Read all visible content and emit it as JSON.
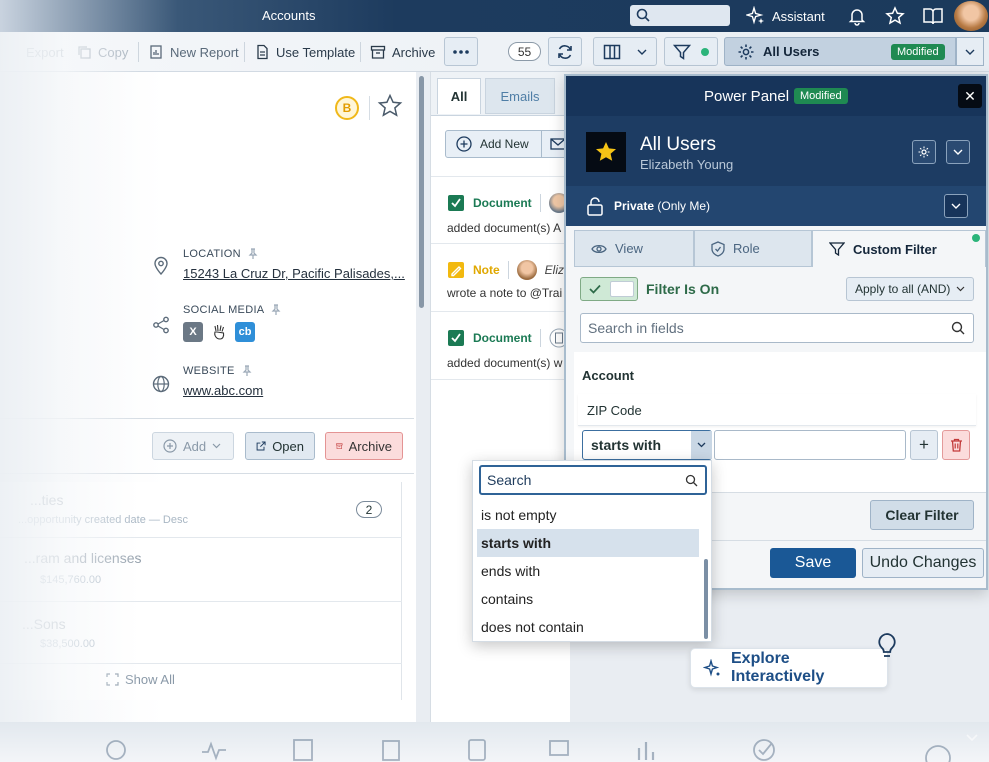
{
  "titlebar": {
    "title": "Accounts",
    "assistant_label": "Assistant"
  },
  "toolbar": {
    "export_label": "Export",
    "copy_label": "Copy",
    "new_report_label": "New Report",
    "use_template_label": "Use Template",
    "archive_label": "Archive",
    "count": "55",
    "view_name": "All Users",
    "view_status": "Modified"
  },
  "record": {
    "location_label": "LOCATION",
    "location_value": "15243 La Cruz Dr, Pacific Palisades,...",
    "social_label": "SOCIAL MEDIA",
    "website_label": "WEBSITE",
    "website_value": "www.abc.com",
    "coin_letter": "B",
    "actions": {
      "add": "Add",
      "open": "Open",
      "archive": "Archive"
    }
  },
  "related": {
    "section_title": "...ties",
    "section_sub": "...opportunity created date — Desc",
    "count": "2",
    "items": [
      {
        "name": "...ram and licenses",
        "value": "$145,760.00"
      },
      {
        "name": "...Sons",
        "value": "$38,500.00"
      }
    ],
    "show_all": "Show All"
  },
  "activity": {
    "tabs": {
      "all": "All",
      "emails": "Emails"
    },
    "add_new": "Add New",
    "items": [
      {
        "type": "Document",
        "text": "added document(s) A"
      },
      {
        "type": "Note",
        "user": "Eliz",
        "text": "wrote a note to @Trai"
      },
      {
        "type": "Document",
        "text": "added document(s) w"
      }
    ]
  },
  "power_panel": {
    "title": "Power Panel",
    "status": "Modified",
    "view_name": "All Users",
    "owner": "Elizabeth Young",
    "privacy_bold": "Private",
    "privacy_rest": " (Only Me)",
    "tabs": {
      "view": "View",
      "role": "Role",
      "custom_filter": "Custom Filter"
    },
    "filter_toggle": "Filter Is On",
    "apply_mode": "Apply to all (AND)",
    "search_placeholder": "Search in fields",
    "group": "Account",
    "field": "ZIP Code",
    "operator": "starts with",
    "clear_filter": "Clear Filter",
    "save": "Save",
    "undo": "Undo Changes"
  },
  "operator_dropdown": {
    "search_placeholder": "Search",
    "options": [
      "is not empty",
      "starts with",
      "ends with",
      "contains",
      "does not contain"
    ],
    "selected_index": 1
  },
  "explore": {
    "label": "Explore Interactively"
  },
  "colors": {
    "navy": "#17345a",
    "accent_blue": "#1a5896",
    "modified_green": "#1f8a52",
    "danger_bg": "#fbdcdc"
  }
}
